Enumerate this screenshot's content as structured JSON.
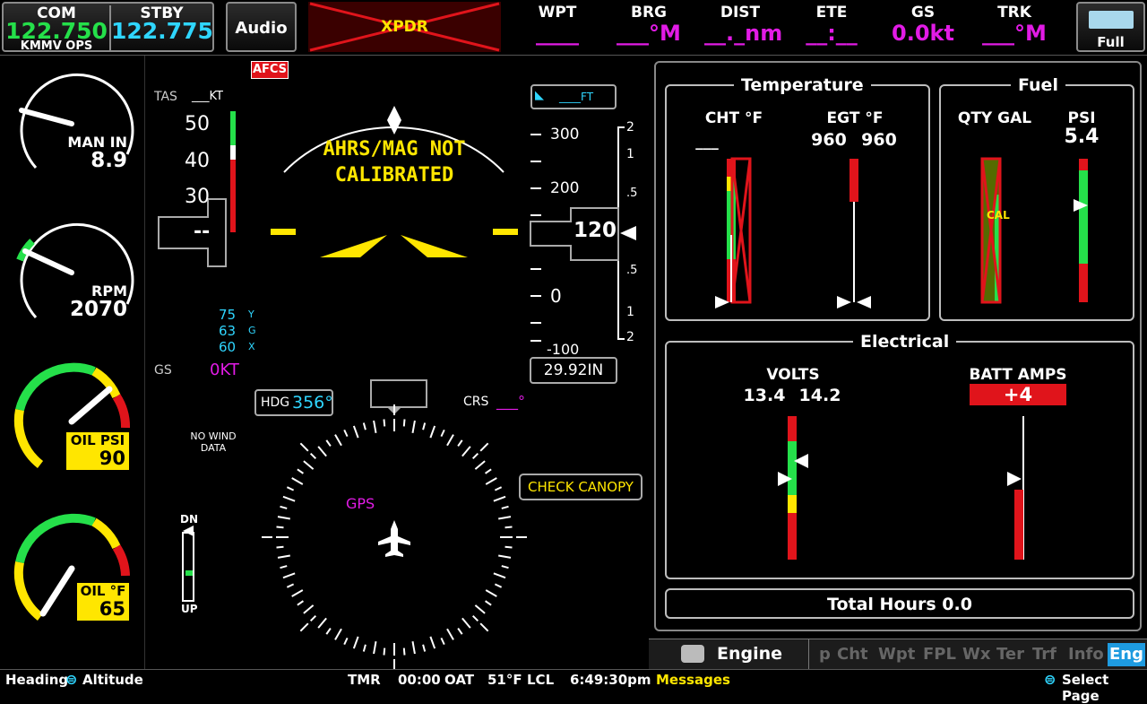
{
  "topbar": {
    "com_label": "COM",
    "com_freq": "122.750",
    "com_station": "KMMV OPS",
    "stby_label": "STBY",
    "stby_freq": "122.775",
    "audio_label": "Audio",
    "xpdr_label": "XPDR",
    "nav_fields": [
      {
        "label": "WPT",
        "value": "____"
      },
      {
        "label": "BRG",
        "value": "___°M"
      },
      {
        "label": "DIST",
        "value": "__._nm"
      },
      {
        "label": "ETE",
        "value": "__:__"
      },
      {
        "label": "GS",
        "value": "0.0kt"
      },
      {
        "label": "TRK",
        "value": "___°M"
      }
    ],
    "full_label": "Full"
  },
  "engine_gauges": {
    "man_in_label": "MAN IN",
    "man_in_value": "8.9",
    "rpm_label": "RPM",
    "rpm_value": "2070",
    "oil_psi_label": "OIL PSI",
    "oil_psi_value": "90",
    "oil_f_label": "OIL °F",
    "oil_f_value": "65"
  },
  "pfd": {
    "afcs_label": "AFCS",
    "tas_label": "TAS",
    "tas_value": "___KT",
    "speed_ticks": [
      "50",
      "40",
      "30"
    ],
    "speed_readout": "--",
    "ahrs_line1": "AHRS/MAG NOT",
    "ahrs_line2": "CALIBRATED",
    "vspeeds": [
      {
        "value": "75",
        "tag": "Y"
      },
      {
        "value": "63",
        "tag": "G"
      },
      {
        "value": "60",
        "tag": "X"
      }
    ],
    "gs_label": "GS",
    "gs_value": "0KT",
    "alt_bug": "____FT",
    "alt_ticks": [
      "300",
      "200",
      "0",
      "-100"
    ],
    "alt_readout": "120",
    "vsi_ticks": [
      "2",
      "1",
      ".5",
      ".5",
      "1",
      "2"
    ],
    "baro": "29.92IN",
    "hdg_label": "HDG",
    "hdg_value": "356°",
    "crs_label": "CRS",
    "crs_value": "___°",
    "wind_line1": "NO WIND",
    "wind_line2": "DATA",
    "gps_label": "GPS",
    "check_canopy": "CHECK CANOPY",
    "flap_dn": "DN",
    "flap_up": "UP"
  },
  "mfd": {
    "temperature_title": "Temperature",
    "cht_label": "CHT °F",
    "cht_value": "___",
    "egt_label": "EGT °F",
    "egt_value_1": "960",
    "egt_value_2": "960",
    "fuel_title": "Fuel",
    "qty_label": "QTY GAL",
    "psi_label": "PSI",
    "psi_value": "5.4",
    "cal_label": "CAL",
    "electrical_title": "Electrical",
    "volts_label": "VOLTS",
    "volts_value_1": "13.4",
    "volts_value_2": "14.2",
    "batt_label": "BATT AMPS",
    "batt_value": "+4",
    "total_hours": "Total Hours 0.0",
    "engine_tab": "Engine",
    "tabs": [
      "p",
      "Cht",
      "Wpt",
      "FPL",
      "Wx",
      "Ter",
      "Trf",
      "Info",
      "Eng"
    ]
  },
  "statusbar": {
    "heading": "Heading",
    "altitude": "Altitude",
    "tmr_label": "TMR",
    "tmr_value": "00:00",
    "oat_label": "OAT",
    "oat_value": "51°F",
    "lcl_label": "LCL",
    "lcl_value": "6:49:30pm",
    "messages": "Messages",
    "select_page": "Select Page"
  },
  "colors": {
    "cyan": "#2fd6ff",
    "green": "#25e04a",
    "magenta": "#e21be6",
    "yellow": "#ffe600",
    "red": "#e0141b"
  }
}
